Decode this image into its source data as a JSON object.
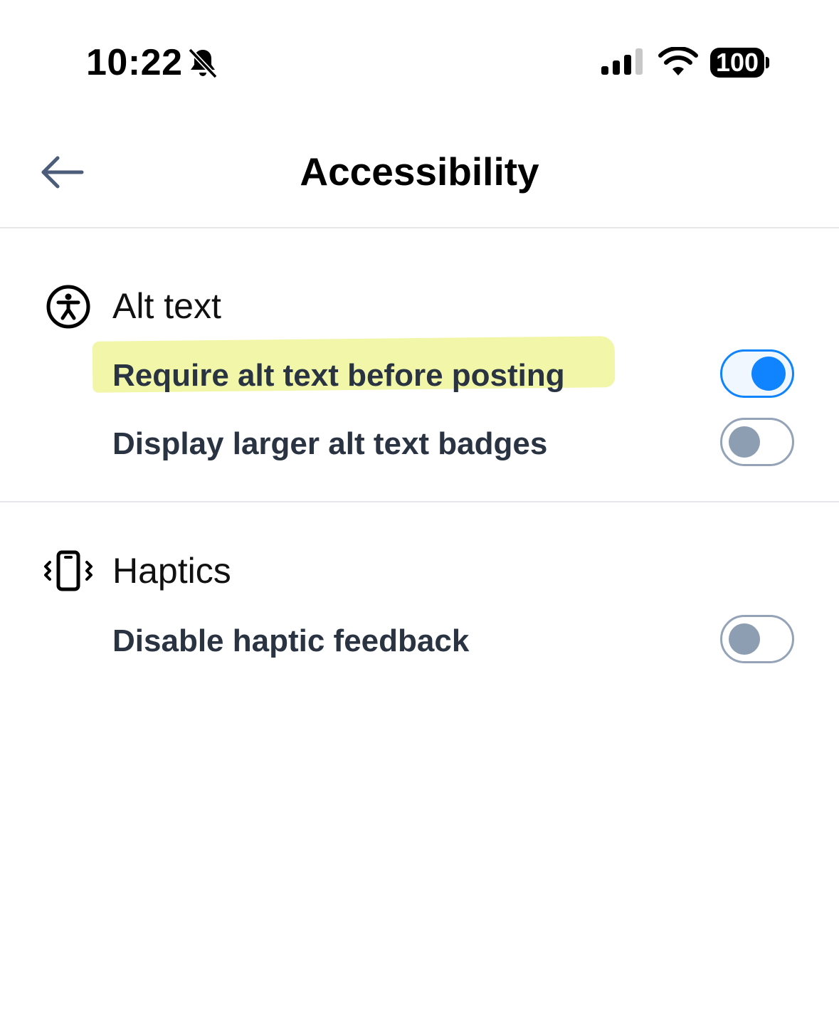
{
  "status_bar": {
    "time": "10:22",
    "battery": "100",
    "icons": [
      "bell-off-icon",
      "signal-icon",
      "wifi-icon",
      "battery-icon"
    ]
  },
  "header": {
    "title": "Accessibility",
    "back_icon": "arrow-left-icon"
  },
  "sections": {
    "alt_text": {
      "title": "Alt text",
      "icon": "accessibility-icon",
      "settings": [
        {
          "label": "Require alt text before posting",
          "enabled": true,
          "highlighted": true
        },
        {
          "label": "Display larger alt text badges",
          "enabled": false,
          "highlighted": false
        }
      ]
    },
    "haptics": {
      "title": "Haptics",
      "icon": "phone-vibrate-icon",
      "settings": [
        {
          "label": "Disable haptic feedback",
          "enabled": false,
          "highlighted": false
        }
      ]
    }
  },
  "colors": {
    "accent": "#1083fe",
    "toggle_off_border": "#94a3b8",
    "toggle_off_knob": "#8d9db2",
    "highlight": "#eef59a",
    "divider": "#e5e7eb",
    "label_text": "#2a3342"
  }
}
